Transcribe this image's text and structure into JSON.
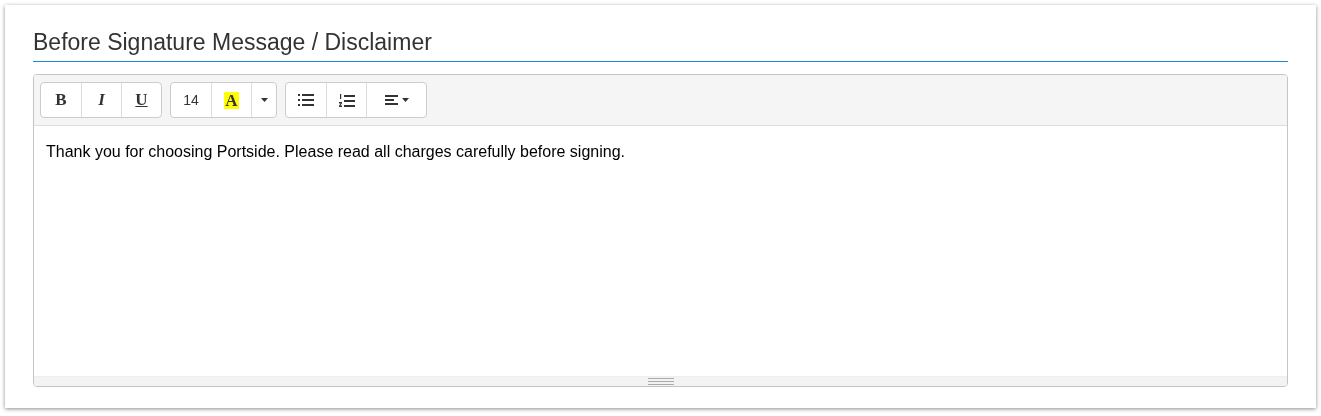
{
  "title": "Before Signature Message / Disclaimer",
  "toolbar": [
    [
      {
        "kind": "bold",
        "label": "B"
      },
      {
        "kind": "italic",
        "label": "I"
      },
      {
        "kind": "underline",
        "label": "U"
      }
    ],
    [
      {
        "kind": "font-size",
        "label": "14"
      },
      {
        "kind": "highlight",
        "label": "A",
        "color": "#ffff00"
      },
      {
        "kind": "dropdown"
      }
    ],
    [
      {
        "kind": "bullet-list"
      },
      {
        "kind": "numbered-list"
      },
      {
        "kind": "align"
      }
    ]
  ],
  "content": "Thank you for choosing Portside. Please read all charges carefully before signing."
}
